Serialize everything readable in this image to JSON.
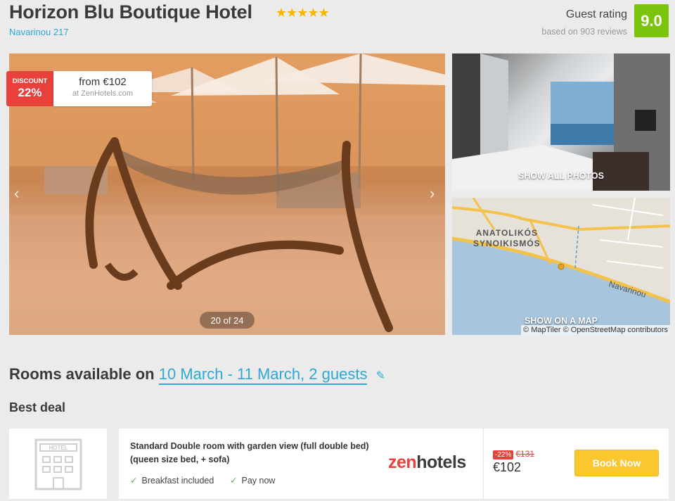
{
  "hotel": {
    "name": "Horizon Blu Boutique Hotel",
    "stars": "★★★★★",
    "address": "Navarinou 217"
  },
  "rating": {
    "label": "Guest rating",
    "subtitle": "based on 903 reviews",
    "score": "9.0",
    "score_color": "#7cc30d"
  },
  "gallery": {
    "discount_label": "DISCOUNT",
    "discount_value": "22%",
    "from_price": "from €102",
    "price_source": "at ZenHotels.com",
    "counter": "20 of 24",
    "prev_icon": "chevron-left-icon",
    "next_icon": "chevron-right-icon",
    "show_all_photos": "SHOW ALL PHOTOS"
  },
  "map": {
    "district_line1": "ANATOLIKÓS",
    "district_line2": "SYNOIKISMÓS",
    "road_name": "Navarinou",
    "show_on_map": "SHOW ON A MAP",
    "attribution": "© MapTiler © OpenStreetMap contributors"
  },
  "rooms": {
    "heading_prefix": "Rooms available on",
    "dates": "10 March - 11 March, 2 guests",
    "edit_icon": "pencil-icon",
    "best_deal": "Best deal"
  },
  "deal": {
    "thumb_label": "HOTEL",
    "room_name": "Standard Double room with garden view (full double bed) (queen size bed, + sofa)",
    "features": [
      "Breakfast included",
      "Pay now"
    ],
    "provider_zen": "zen",
    "provider_hotels": "hotels",
    "discount_pct": "-22%",
    "old_price": "€131",
    "price": "€102",
    "book_label": "Book Now",
    "accent_color": "#fcc62e"
  }
}
